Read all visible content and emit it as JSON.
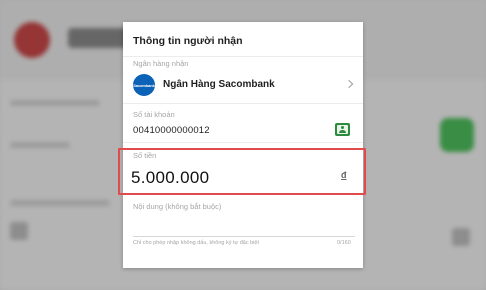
{
  "dialog": {
    "title": "Thông tin người nhận",
    "bank": {
      "label": "Ngân hàng nhận",
      "logo_text": "Sacombank",
      "name": "Ngân Hàng Sacombank"
    },
    "account": {
      "label": "Số tài khoản",
      "value": "00410000000012"
    },
    "amount": {
      "label": "Số tiền",
      "value": "5.000.000",
      "currency": "đ"
    },
    "note": {
      "placeholder": "Nội dung (không bắt buộc)",
      "hint": "Chỉ cho phép nhập không dấu, không ký tự đặc biệt",
      "counter": "0/160"
    }
  },
  "colors": {
    "highlight": "#e14b4b",
    "bank_logo": "#0b62b6",
    "contact_icon": "#2e8a3e"
  },
  "icons": {
    "bank": "sacombank-logo-icon",
    "chevron": "chevron-right-icon",
    "contact": "contact-book-icon"
  }
}
